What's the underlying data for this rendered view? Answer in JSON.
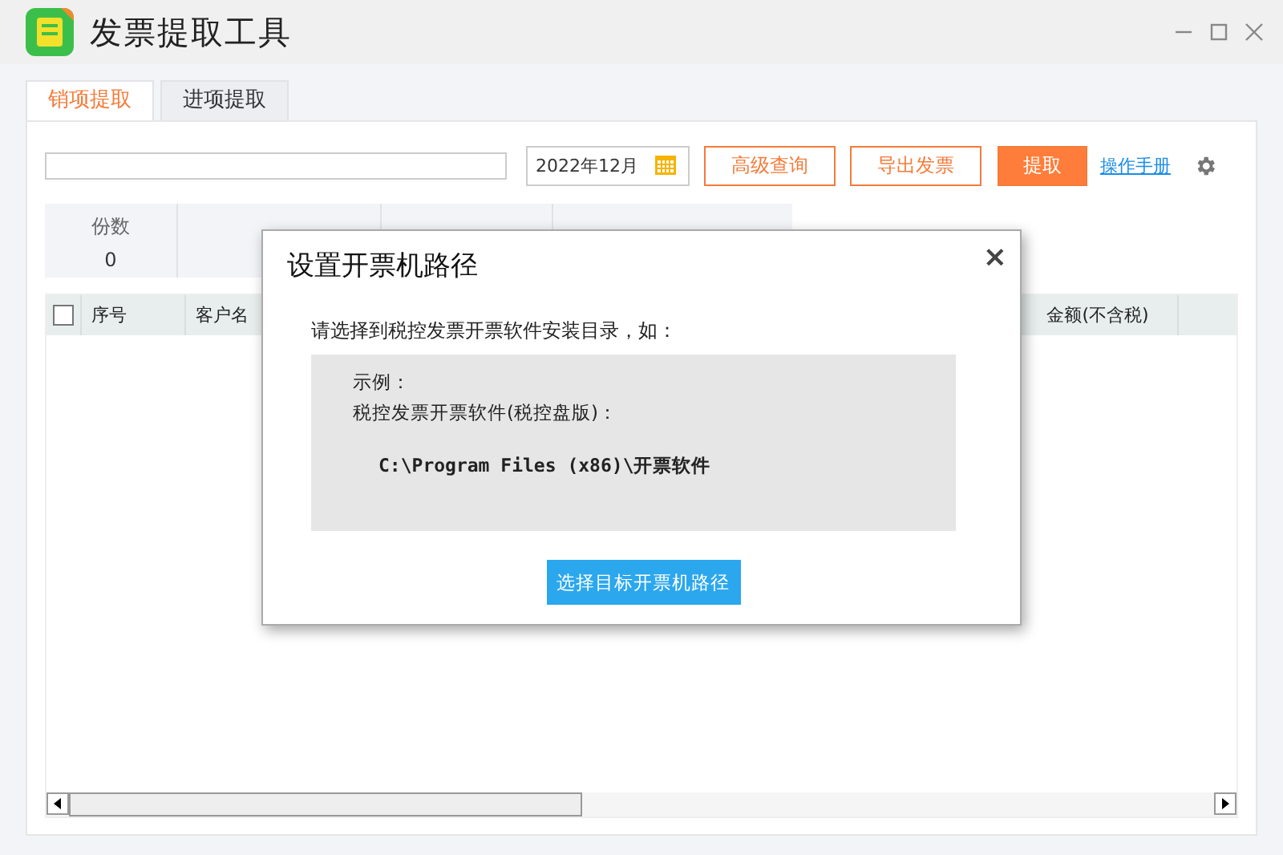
{
  "window": {
    "title": "发票提取工具"
  },
  "tabs": [
    {
      "label": "销项提取",
      "selected": true
    },
    {
      "label": "进项提取",
      "selected": false
    }
  ],
  "toolbar": {
    "date": "2022年12月",
    "buttons": [
      {
        "label": "高级查询",
        "kind": "outline"
      },
      {
        "label": "导出发票",
        "kind": "outline"
      },
      {
        "label": "提取",
        "kind": "primary"
      }
    ],
    "link": "操作手册"
  },
  "stats": [
    {
      "label": "份数",
      "value": "0"
    }
  ],
  "table": {
    "select_all": {
      "checked": false
    },
    "columns": [
      "序号",
      "客户名",
      "金额(不含税)"
    ]
  },
  "dialog": {
    "title": "设置开票机路径",
    "close": "×",
    "intro": "请选择到税控发票开票软件安装目录，如：",
    "example_label": "示例：",
    "example_name": "税控发票开票软件(税控盘版)：",
    "example_path": "C:\\Program Files (x86)\\开票软件",
    "button": "选择目标开票机路径"
  }
}
